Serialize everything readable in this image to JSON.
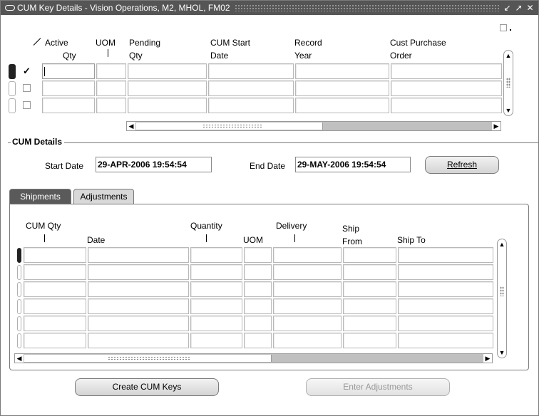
{
  "window": {
    "title": "CUM Key Details - Vision Operations, M2, MHOL, FM02",
    "controls": {
      "minimize": "↙",
      "maximize": "↗",
      "close": "✕"
    }
  },
  "top_table": {
    "headers": {
      "active_qty": [
        "Active",
        "Qty"
      ],
      "uom": "UOM",
      "pending_qty": [
        "Pending",
        "Qty"
      ],
      "cum_start_date": [
        "CUM Start",
        "Date"
      ],
      "record_year": [
        "Record",
        "Year"
      ],
      "cust_purchase_order": [
        "Cust Purchase",
        "Order"
      ]
    },
    "rows": [
      {
        "active": true
      },
      {
        "active": false
      },
      {
        "active": false
      }
    ]
  },
  "cum_details": {
    "title": "CUM Details",
    "start_date_label": "Start Date",
    "start_date_value": "29-APR-2006 19:54:54",
    "end_date_label": "End Date",
    "end_date_value": "29-MAY-2006 19:54:54",
    "refresh_label": "Refresh"
  },
  "tabs": {
    "shipments": "Shipments",
    "adjustments": "Adjustments",
    "selected": "shipments"
  },
  "shipments_table": {
    "headers": {
      "cum_qty": "CUM Qty",
      "date": "Date",
      "quantity": "Quantity",
      "uom": "UOM",
      "delivery": "Delivery",
      "ship_from": [
        "Ship",
        "From"
      ],
      "ship_to": "Ship To"
    },
    "row_count": 6
  },
  "buttons": {
    "create_cum_keys": "Create CUM Keys",
    "enter_adjustments": "Enter Adjustments"
  }
}
